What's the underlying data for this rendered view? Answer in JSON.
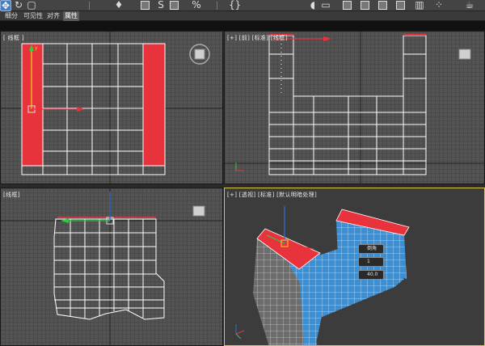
{
  "toolbar": {
    "icons": [
      "select-move-icon",
      "rotate-icon",
      "snap-toggle-icon",
      "spinner-snap-icon",
      "percent-snap-icon",
      "brace-icon",
      "mirror-icon",
      "layer-icon",
      "render-setup-icon",
      "render-frame-icon",
      "teapot-icon"
    ],
    "tools": {
      "snap": "S",
      "percent": "%",
      "brace": "{}"
    }
  },
  "ribbon": {
    "tabs": [
      "细分",
      "可见性",
      "对齐",
      "属性"
    ],
    "active": "属性"
  },
  "viewports": {
    "top_left": {
      "label": "[ 线框 ]"
    },
    "top_right": {
      "label": "[+] [前] [标准] [线框]"
    },
    "bottom_left": {
      "label": "[线框]"
    },
    "bottom_right": {
      "label": "[+] [透视] [标准] [默认明暗处理]"
    }
  },
  "tooltip": {
    "line1": "倒角",
    "line2": "1",
    "line3": "40.0"
  },
  "colors": {
    "selected_face": "#e8333c",
    "mesh_blue": "#3d8fd1",
    "wire": "#ffffff",
    "active_border": "#d8c84a"
  }
}
